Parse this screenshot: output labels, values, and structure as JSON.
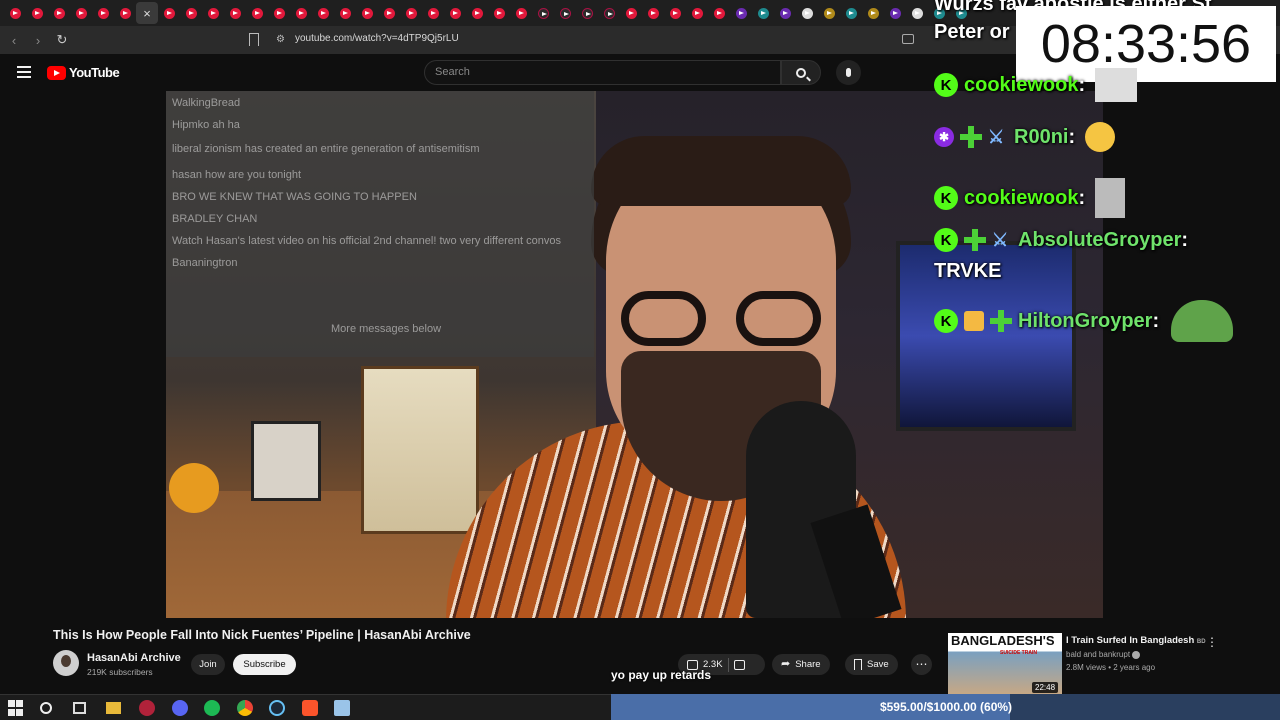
{
  "browser": {
    "url": "youtube.com/watch?v=4dTP9Qj5rLU"
  },
  "header": {
    "logo_text": "YouTube",
    "search_placeholder": "Search"
  },
  "stream_overlay": {
    "top_text_1": "Wurzs fav apostle is either St",
    "top_text_2": "Peter or",
    "clock": "08:33:56",
    "chat": [
      {
        "user": "cookiewook",
        "colon": ":"
      },
      {
        "user": "R00ni",
        "colon": ":"
      },
      {
        "user": "cookiewook",
        "colon": ":"
      },
      {
        "user": "AbsoluteGroyper",
        "colon": ":",
        "message": "TRVKE"
      },
      {
        "user": "HiltonGroyper",
        "colon": ":"
      }
    ]
  },
  "video": {
    "title": "This Is How People Fall Into Nick Fuentes’ Pipeline | HasanAbi Archive",
    "ghost_chat": [
      "WalkingBread",
      "Hipmko ah ha",
      "liberal zionism has created an entire generation of antisemitism",
      "hasan how are you tonight",
      "BRO WE KNEW THAT WAS GOING TO HAPPEN",
      "BRADLEY CHAN",
      "Watch Hasan's latest video on his official 2nd channel! two very different convos",
      "Bananingtron",
      "More messages below"
    ]
  },
  "channel": {
    "name": "HasanAbi Archive",
    "subscribers": "219K subscribers",
    "join_label": "Join",
    "subscribe_label": "Subscribe"
  },
  "actions": {
    "likes": "2.3K",
    "share_label": "Share",
    "save_label": "Save",
    "more_label": "⋯"
  },
  "tts_text": "yo pay up retards",
  "recommended": {
    "thumb_text": "BANGLADESH'S",
    "thumb_subtext": "SUICIDE TRAIN",
    "duration": "22:48",
    "title": "I Train Surfed In Bangladesh",
    "flag": "BD",
    "channel": "bald and bankrupt",
    "meta": "2.8M views • 2 years ago"
  },
  "donation_goal": {
    "text": "$595.00/$1000.00 (60%)",
    "progress_fraction": 0.595
  },
  "colors": {
    "youtube_red": "#ff0000",
    "kick_green": "#53fc18",
    "background": "#0f0f0f"
  }
}
